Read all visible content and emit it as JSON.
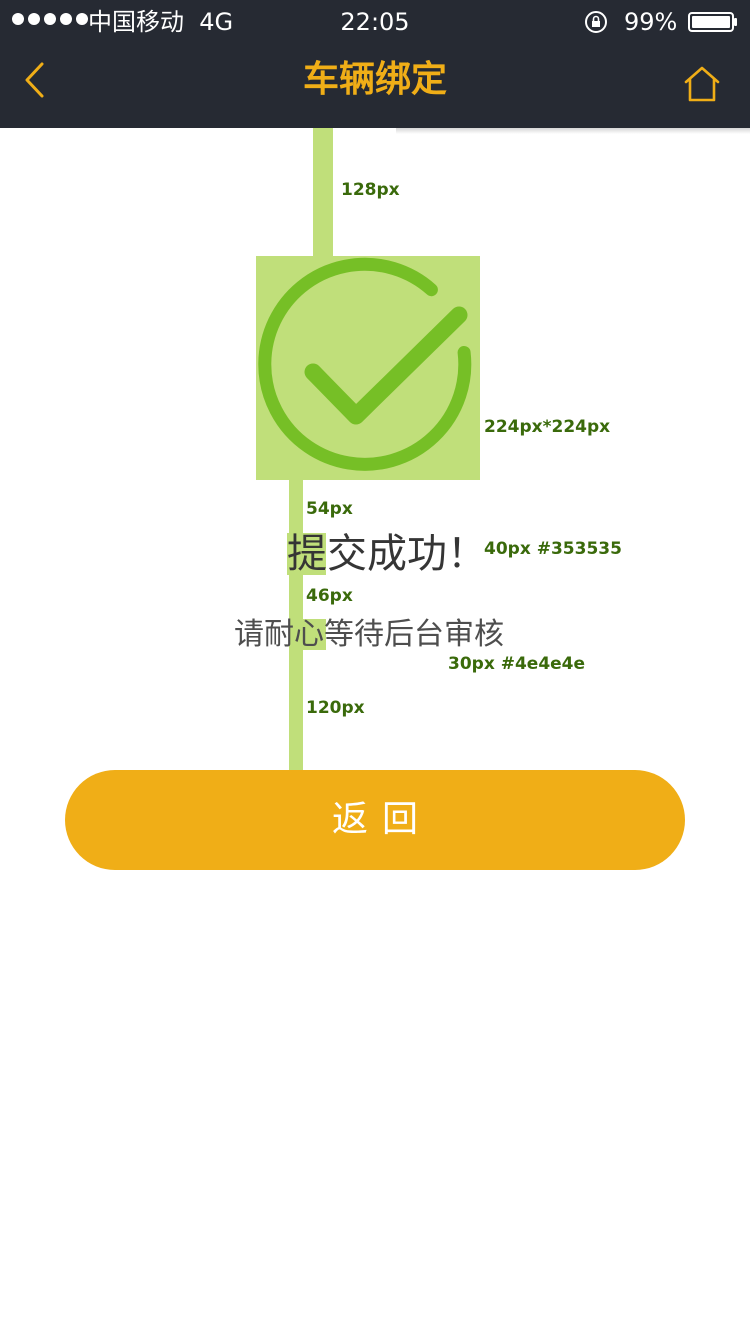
{
  "status_bar": {
    "carrier": "中国移动",
    "network": "4G",
    "time": "22:05",
    "battery": "99%"
  },
  "nav": {
    "title": "车辆绑定",
    "back_icon": "chevron-left-icon",
    "home_icon": "home-icon"
  },
  "content": {
    "success_icon": "check-circle-icon",
    "title": "提交成功！",
    "message": "请耐心等待后台审核"
  },
  "button": {
    "label": "返回"
  },
  "annotations": {
    "top_spacing": "128px",
    "icon_size": "224px*224px",
    "icon_to_title": "54px",
    "title_spec": "40px  #353535",
    "title_to_message": "46px",
    "message_spec": "30px #4e4e4e",
    "message_to_button": "120px"
  },
  "colors": {
    "header_bg": "#262a33",
    "accent": "#f0ae17",
    "title_text": "#353535",
    "message_text": "#4e4e4e",
    "success_green": "#76bf26",
    "guide_green": "#c0df7a",
    "annotation_text": "#3a6a0b"
  }
}
